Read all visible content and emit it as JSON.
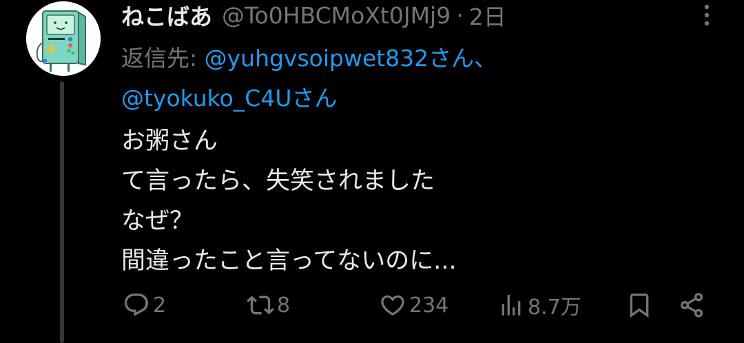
{
  "tweet": {
    "display_name": "ねこばあ",
    "handle": "@To0HBCMoXt0JMj9",
    "separator": "·",
    "time": "2日",
    "reply_label": "返信先:",
    "reply_mention_1": "@yuhgvsoipwet832さん",
    "reply_sep": "、",
    "reply_mention_2": "@tyokuko_C4Uさん",
    "lines": [
      "お粥さん",
      "て言ったら、失笑されました",
      "なぜ？",
      "間違ったこと言ってないのに..."
    ]
  },
  "actions": {
    "replies": "2",
    "retweets": "8",
    "likes": "234",
    "views": "8.7万"
  },
  "icons": {
    "avatar": "bmo-avatar",
    "more": "more-vertical-icon",
    "reply": "reply-icon",
    "retweet": "retweet-icon",
    "like": "heart-icon",
    "views": "views-chart-icon",
    "bookmark": "bookmark-icon",
    "share": "share-icon"
  },
  "colors": {
    "background": "#000000",
    "text": "#e7e9ea",
    "muted": "#71767b",
    "link": "#1d9bf0",
    "avatar_body": "#7fd6c0"
  }
}
